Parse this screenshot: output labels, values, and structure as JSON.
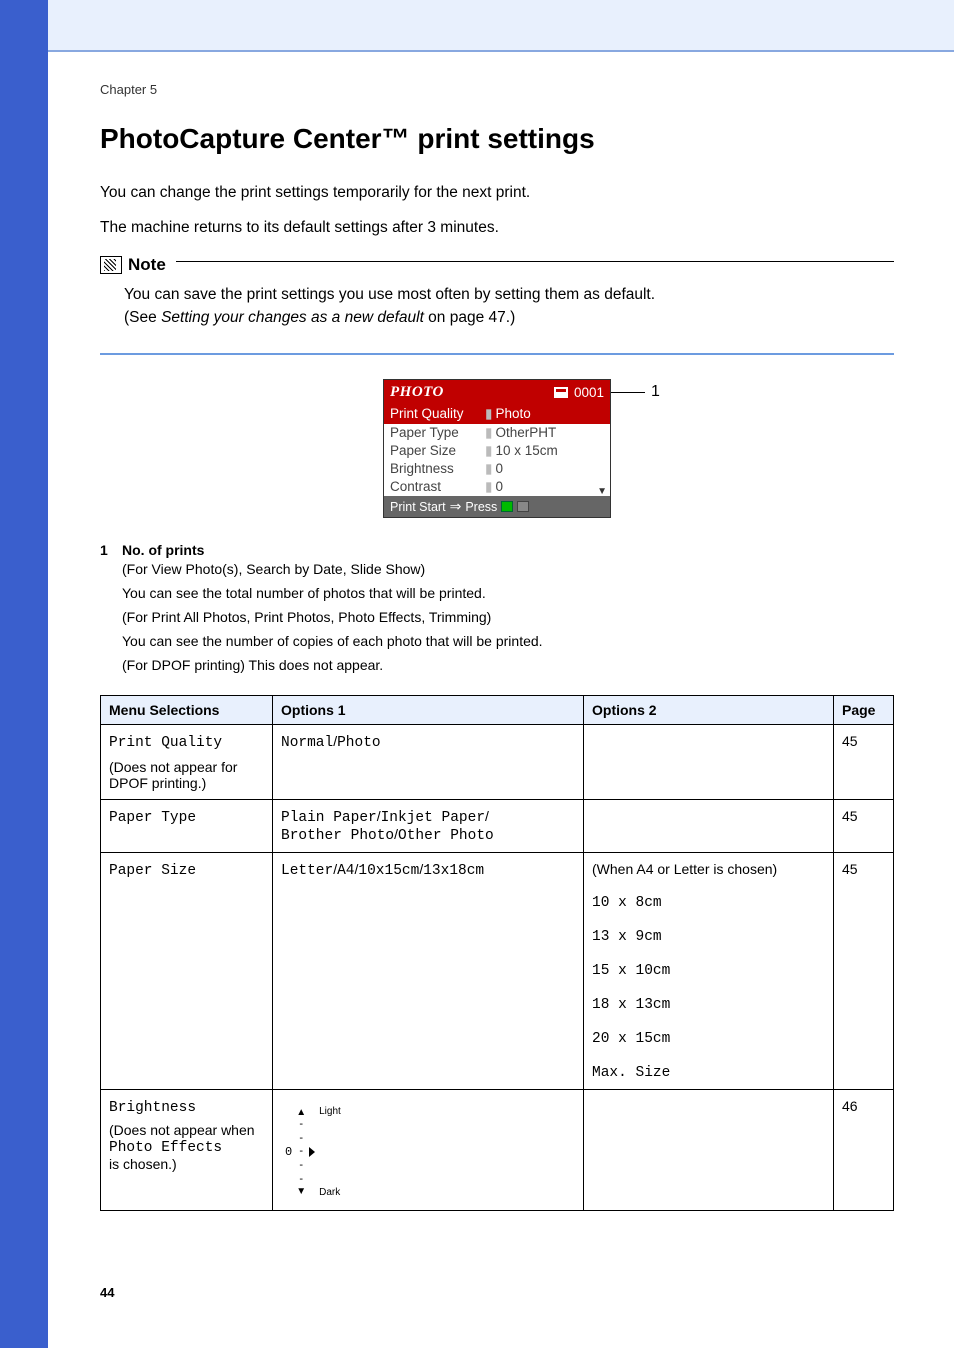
{
  "chapter": "Chapter 5",
  "title": "PhotoCapture Center™ print settings",
  "para1": "You can change the print settings temporarily for the next print.",
  "para2": "The machine returns to its default settings after 3 minutes.",
  "note": {
    "label": "Note",
    "line1": "You can save the print settings you use most often by setting them as default.",
    "line2_pre": "(See ",
    "line2_em": "Setting your changes as a new default",
    "line2_post": " on page 47.)"
  },
  "lcd": {
    "title": "PHOTO",
    "count": "0001",
    "rows": [
      {
        "k": "Print Quality",
        "v": "Photo",
        "sel": true
      },
      {
        "k": "Paper Type",
        "v": "OtherPHT",
        "sel": false
      },
      {
        "k": "Paper Size",
        "v": "10 x 15cm",
        "sel": false
      },
      {
        "k": "Brightness",
        "v": "0",
        "sel": false
      },
      {
        "k": "Contrast",
        "v": "0",
        "sel": false
      }
    ],
    "footer_a": "Print Start",
    "footer_arrow": "⇒",
    "footer_b": "Press"
  },
  "callout": {
    "num": "1",
    "title": "No. of prints",
    "l1": "(For View Photo(s), Search by Date, Slide Show)",
    "l2": "You can see the total number of photos that will be printed.",
    "l3": "(For Print All Photos, Print Photos, Photo Effects, Trimming)",
    "l4": "You can see the number of copies of each photo that will be printed.",
    "l5": "(For DPOF printing) This does not appear."
  },
  "headers": {
    "a": "Menu Selections",
    "b": "Options 1",
    "c": "Options 2",
    "d": "Page"
  },
  "rows": {
    "r1": {
      "a_mono": "Print Quality",
      "a_note": "(Does not appear for DPOF printing.)",
      "b_tokens": [
        "Normal",
        "Photo"
      ],
      "page": "45"
    },
    "r2": {
      "a_mono": "Paper Type",
      "b_tokens": [
        "Plain Paper",
        "Inkjet Paper",
        "Brother Photo",
        "Other Photo"
      ],
      "page": "45"
    },
    "r3": {
      "a_mono": "Paper Size",
      "b_tokens": [
        "Letter",
        "A4",
        "10x15cm",
        "13x18cm"
      ],
      "c_note": "(When A4 or Letter is chosen)",
      "c_sizes": [
        "10 x 8cm",
        "13 x 9cm",
        "15 x 10cm",
        "18 x 13cm",
        "20 x 15cm",
        "Max. Size"
      ],
      "page": "45"
    },
    "r4": {
      "a_mono": "Brightness",
      "a_note1": "(Does not appear when",
      "a_note_mono": "Photo Effects",
      "a_note2": "is chosen.)",
      "light": "Light",
      "dark": "Dark",
      "zero": "0",
      "page": "46"
    }
  },
  "page_number": "44"
}
